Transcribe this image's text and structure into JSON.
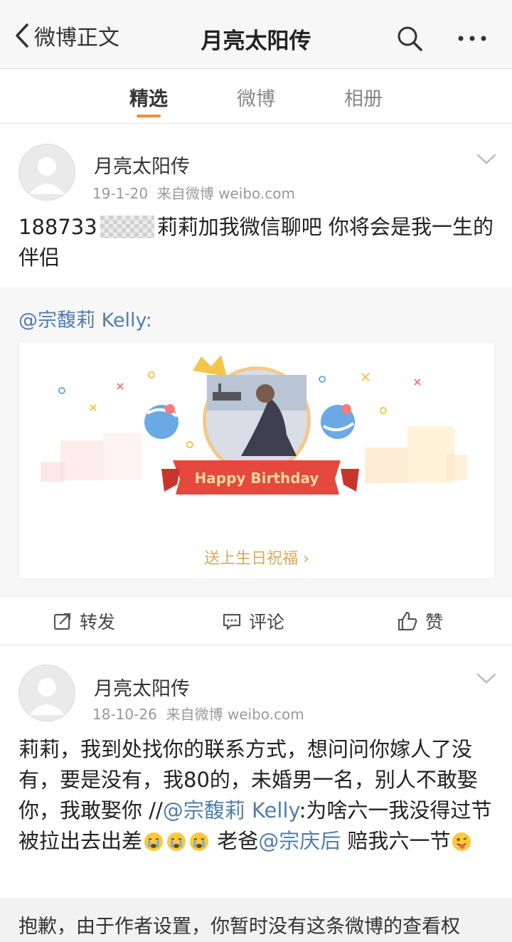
{
  "navbar": {
    "back_label": "微博正文",
    "title": "月亮太阳传",
    "icons": [
      "chevron-left-icon",
      "search-icon",
      "more-icon"
    ]
  },
  "tabs": [
    {
      "label": "精选",
      "active": true
    },
    {
      "label": "微博",
      "active": false
    },
    {
      "label": "相册",
      "active": false
    }
  ],
  "post1": {
    "author": "月亮太阳传",
    "date": "19-1-20",
    "source": "来自微博 weibo.com",
    "text_prefix": "188733",
    "text_rest": "莉莉加我微信聊吧 你将会是我一生的伴侣",
    "repost": {
      "author": "@宗馥莉 Kelly:",
      "card_banner": "Happy Birthday",
      "card_cta": "送上生日祝福 ›"
    },
    "actions": {
      "repost": "转发",
      "comment": "评论",
      "like": "赞"
    }
  },
  "post2": {
    "author": "月亮太阳传",
    "date": "18-10-26",
    "source": "来自微博 weibo.com",
    "text_a": "莉莉，我到处找你的联系方式，想问问你嫁人了没有，要是没有，我80的，未婚男一名，别人不敢娶你，我敢娶你 //",
    "mention1": "@宗馥莉 Kelly",
    "text_b": ":为啥六一我没得过节 被拉出去出差",
    "text_c": " 老爸",
    "mention2": "@宗庆后",
    "text_d": " 赔我六一节"
  },
  "notice": "抱歉，由于作者设置，你暂时没有这条微博的查看权",
  "colors": {
    "accent": "#f58c3b",
    "link": "#507daf",
    "background": "#f2f2f2"
  }
}
